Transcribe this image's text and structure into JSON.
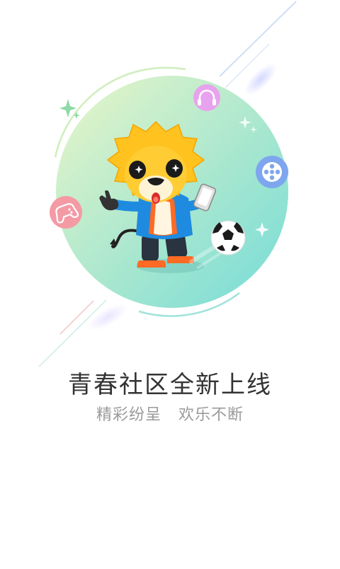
{
  "splash": {
    "title": "青春社区全新上线",
    "subtitle": "精彩纷呈   欢乐不断"
  },
  "icons": {
    "headphones": "headphones-icon",
    "film": "film-reel-icon",
    "gamepad": "gamepad-icon",
    "ball": "soccer-ball-icon",
    "mascot": "lion-mascot-illustration",
    "sparkle": "sparkle-icon"
  },
  "colors": {
    "circle_top": "#dff3c6",
    "circle_bottom": "#86dfd6",
    "mascot_yellow": "#ffc21f",
    "jacket_blue": "#1e8be0",
    "jacket_orange": "#ff6a25",
    "headphones_bg": "#e9a6ee",
    "film_bg": "#7aa3ef",
    "gamepad_bg": "#f49aa4"
  }
}
